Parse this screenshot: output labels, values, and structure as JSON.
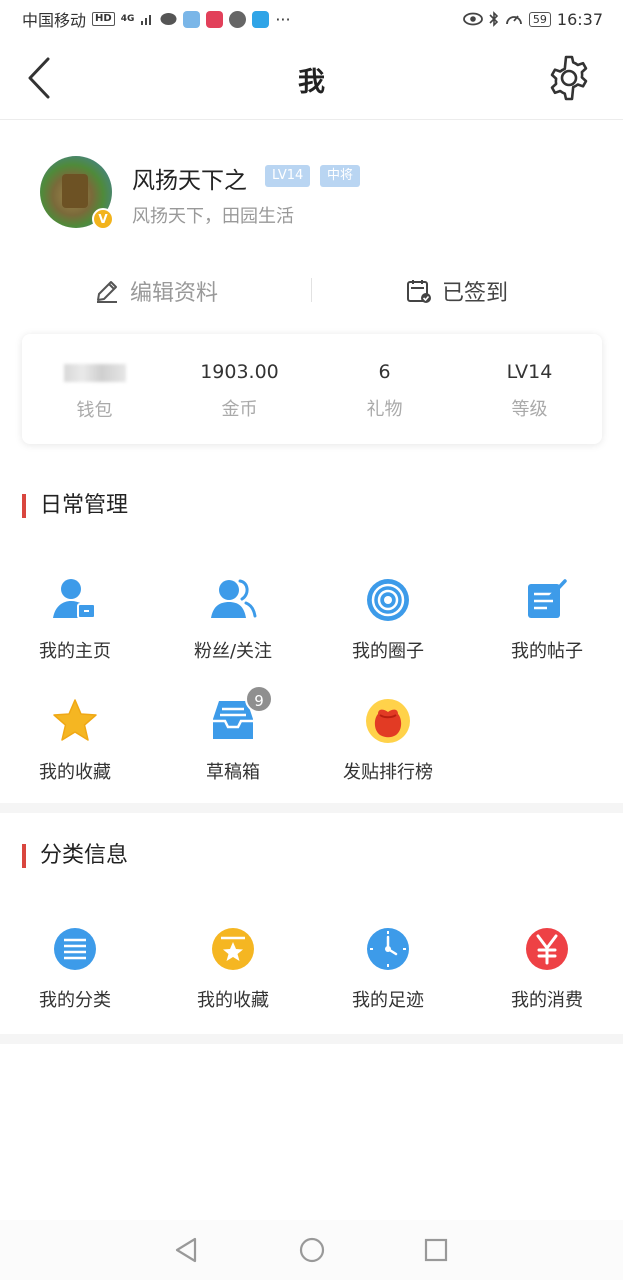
{
  "status_bar": {
    "carrier": "中国移动",
    "hd": "HD",
    "network": "4G",
    "more": "···",
    "battery": "59",
    "time": "16:37"
  },
  "header": {
    "title": "我",
    "back_icon": "chevron-left-icon",
    "settings_icon": "gear-icon"
  },
  "profile": {
    "username": "风扬天下之",
    "level_badge": "LV14",
    "rank_badge": "中将",
    "signature": "风扬天下，田园生活",
    "verified_mark": "V"
  },
  "actions": {
    "edit_label": "编辑资料",
    "checkin_label": "已签到"
  },
  "stats": [
    {
      "label": "钱包",
      "value": ""
    },
    {
      "label": "金币",
      "value": "1903.00"
    },
    {
      "label": "礼物",
      "value": "6"
    },
    {
      "label": "等级",
      "value": "LV14"
    }
  ],
  "daily": {
    "title": "日常管理",
    "items": [
      {
        "label": "我的主页",
        "icon": "user-card-icon"
      },
      {
        "label": "粉丝/关注",
        "icon": "users-icon"
      },
      {
        "label": "我的圈子",
        "icon": "circle-target-icon"
      },
      {
        "label": "我的帖子",
        "icon": "edit-note-icon"
      },
      {
        "label": "我的收藏",
        "icon": "star-icon"
      },
      {
        "label": "草稿箱",
        "icon": "inbox-tray-icon",
        "badge": "9"
      },
      {
        "label": "发贴排行榜",
        "icon": "red-pouch-icon"
      }
    ]
  },
  "category": {
    "title": "分类信息",
    "items": [
      {
        "label": "我的分类",
        "icon": "list-icon"
      },
      {
        "label": "我的收藏",
        "icon": "star-circle-icon"
      },
      {
        "label": "我的足迹",
        "icon": "clock-icon"
      },
      {
        "label": "我的消费",
        "icon": "yen-icon"
      }
    ]
  },
  "colors": {
    "accent_red": "#d9463e",
    "blue": "#3d9be9",
    "yellow": "#f5b622",
    "red": "#ee4145",
    "badge_blue": "#b9d5f2"
  }
}
